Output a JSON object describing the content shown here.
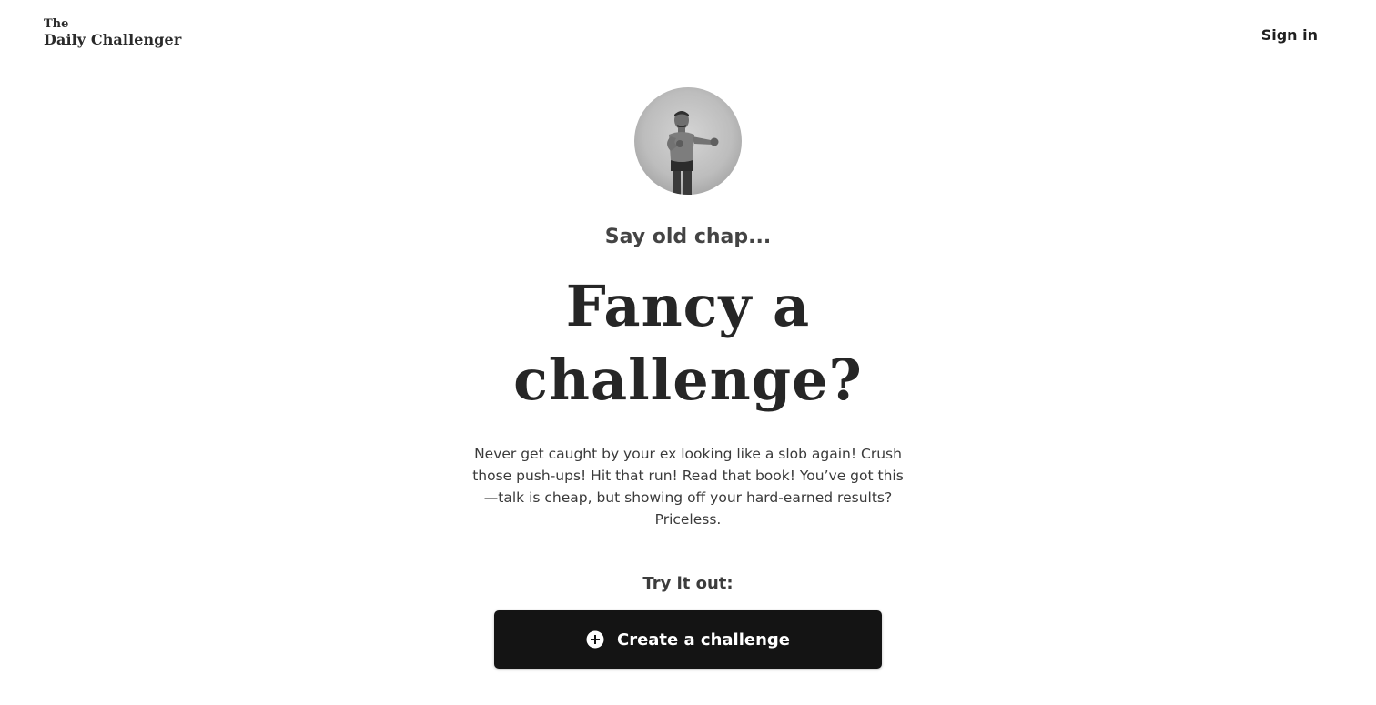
{
  "header": {
    "logo_line1": "The",
    "logo_line2": "Daily Challenger",
    "signin_label": "Sign in"
  },
  "hero": {
    "kicker": "Say old chap...",
    "headline": "Fancy a challenge?",
    "blurb": "Never get caught by your ex looking like a slob again! Crush those push-ups! Hit that run! Read that book! You’ve got this—talk is cheap, but showing off your hard-earned results? Priceless."
  },
  "cta": {
    "prompt": "Try it out:",
    "button_label": "Create a challenge",
    "button_icon": "plus-circle-icon"
  },
  "colors": {
    "background": "#ffffff",
    "button_bg": "#141414",
    "button_text": "#ffffff",
    "text_dark": "#262626"
  }
}
